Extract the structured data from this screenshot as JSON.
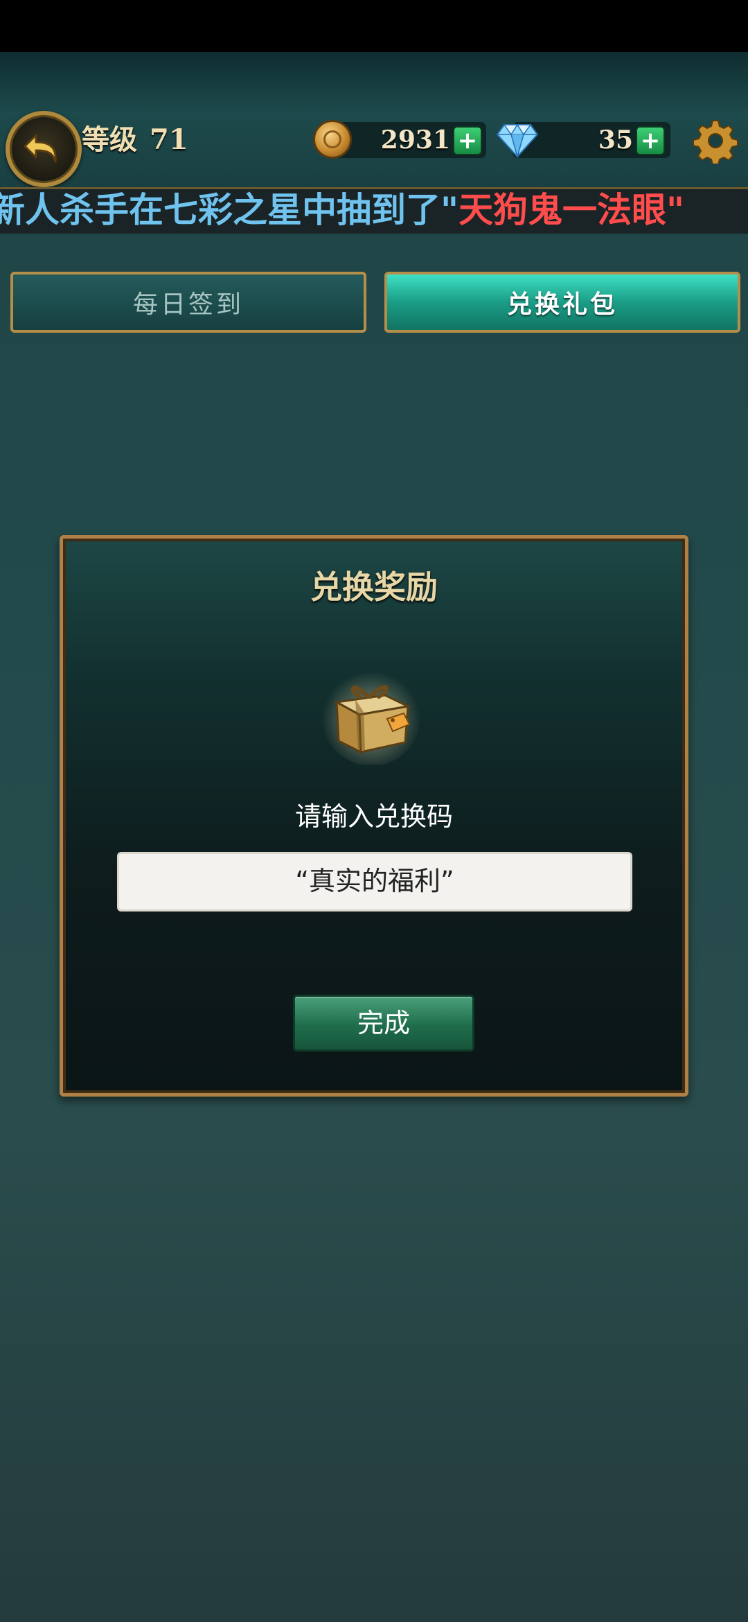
{
  "header": {
    "level_label": "等级",
    "level_value": "71",
    "coins": "2931",
    "gems": "35",
    "plus": "+"
  },
  "marquee": {
    "text_main": "新人杀手在七彩之星中抽到了\"",
    "text_highlight": "天狗鬼一法眼\""
  },
  "tabs": [
    {
      "label": "每日签到",
      "active": false
    },
    {
      "label": "兑换礼包",
      "active": true
    }
  ],
  "dialog": {
    "title": "兑换奖励",
    "prompt": "请输入兑换码",
    "input_value": "“真实的福利”",
    "done_label": "完成"
  },
  "colors": {
    "accent_gold": "#b08147",
    "active_tab": "#1a9d86",
    "marquee_blue": "#6fc3ee",
    "marquee_red": "#ff4d4d"
  },
  "icons": [
    "back-arrow-icon",
    "coin-icon",
    "diamond-icon",
    "gear-icon",
    "gift-box-icon"
  ]
}
